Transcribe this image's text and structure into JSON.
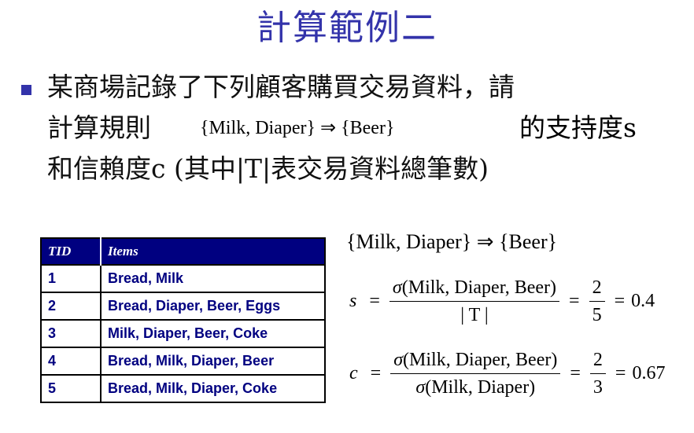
{
  "title": "計算範例二",
  "body": {
    "line1": "某商場記錄了下列顧客購買交易資料，請",
    "line2_prefix": "計算規則",
    "line2_suffix": "的支持度s",
    "line3": "和信賴度c (其中|T|表交易資料總筆數)"
  },
  "rule": {
    "antecedent": "{Milk, Diaper}",
    "arrow": "⇒",
    "consequent": "{Beer}"
  },
  "table": {
    "headers": [
      "TID",
      "Items"
    ],
    "rows": [
      {
        "tid": "1",
        "items": "Bread, Milk"
      },
      {
        "tid": "2",
        "items": "Bread, Diaper, Beer, Eggs"
      },
      {
        "tid": "3",
        "items": "Milk, Diaper, Beer, Coke"
      },
      {
        "tid": "4",
        "items": "Bread, Milk, Diaper, Beer"
      },
      {
        "tid": "5",
        "items": "Bread, Milk, Diaper, Coke"
      }
    ]
  },
  "support": {
    "var": "s",
    "eq": "=",
    "sigma": "σ",
    "numerator": "(Milk, Diaper, Beer)",
    "denominator": "| T |",
    "value_num": "2",
    "value_den": "5",
    "result": "0.4"
  },
  "confidence": {
    "var": "c",
    "eq": "=",
    "sigma": "σ",
    "numerator": "(Milk, Diaper, Beer)",
    "denominator": "(Milk, Diaper)",
    "value_num": "2",
    "value_den": "3",
    "result": "0.67"
  },
  "colors": {
    "title": "#3333aa",
    "bullet": "#3333aa",
    "table_header_bg": "#000080",
    "table_text": "#000080"
  },
  "icons": {
    "bullet": "square-bullet-icon"
  }
}
